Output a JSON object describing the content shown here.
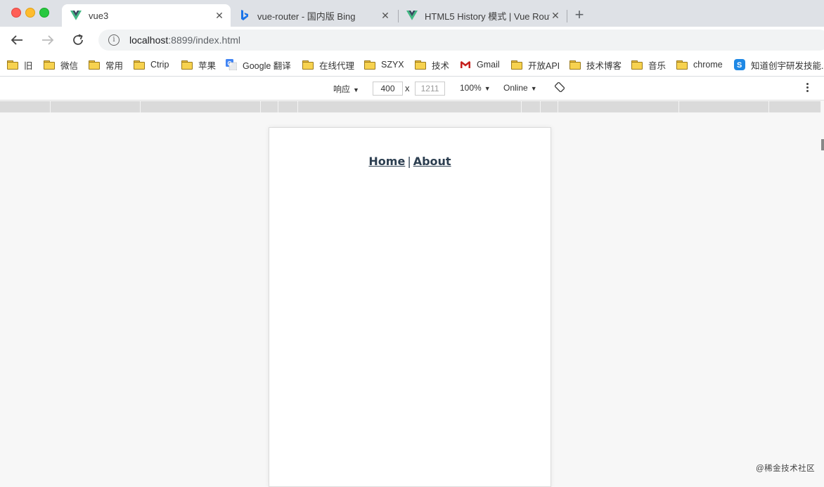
{
  "tabs": [
    {
      "title": "vue3",
      "icon": "vue-logo-icon",
      "active": true
    },
    {
      "title": "vue-router - 国内版 Bing",
      "icon": "bing-icon",
      "active": false
    },
    {
      "title": "HTML5 History 模式 | Vue Rout",
      "icon": "vue-logo-icon",
      "active": false
    }
  ],
  "address": {
    "host": "localhost",
    "rest": ":8899/index.html"
  },
  "bookmarks": [
    {
      "label": "旧",
      "icon": "folder-icon"
    },
    {
      "label": "微信",
      "icon": "folder-icon"
    },
    {
      "label": "常用",
      "icon": "folder-icon"
    },
    {
      "label": "Ctrip",
      "icon": "folder-icon"
    },
    {
      "label": "苹果",
      "icon": "folder-icon"
    },
    {
      "label": "Google 翻译",
      "icon": "google-translate-icon"
    },
    {
      "label": "在线代理",
      "icon": "folder-icon"
    },
    {
      "label": "SZYX",
      "icon": "folder-icon"
    },
    {
      "label": "技术",
      "icon": "folder-icon"
    },
    {
      "label": "Gmail",
      "icon": "gmail-icon"
    },
    {
      "label": "开放API",
      "icon": "folder-icon"
    },
    {
      "label": "技术博客",
      "icon": "folder-icon"
    },
    {
      "label": "音乐",
      "icon": "folder-icon"
    },
    {
      "label": "chrome",
      "icon": "folder-icon"
    },
    {
      "label": "知道创宇研发技能...",
      "icon": "knownsec-icon"
    }
  ],
  "devtools": {
    "device_mode": "响应",
    "width": "400",
    "times": "x",
    "height": "1211",
    "zoom": "100%",
    "network": "Online"
  },
  "page": {
    "home_link": "Home",
    "separator": "|",
    "about_link": "About"
  },
  "watermark": "@稀金技术社区",
  "colors": {
    "link": "#2c3e50",
    "vue_green": "#41b883",
    "vue_dark": "#35495e"
  }
}
